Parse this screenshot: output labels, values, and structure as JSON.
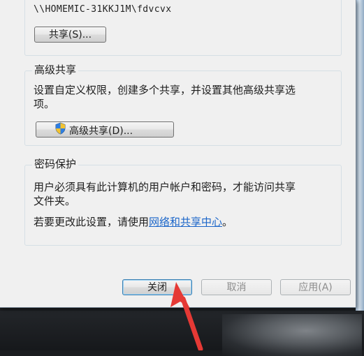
{
  "share": {
    "network_path": "\\\\HOMEMIC-31KKJ1M\\fdvcvx",
    "share_button": "共享(S)..."
  },
  "advanced": {
    "title": "高级共享",
    "description_line1": "设置自定义权限，创建多个共享，并设置其他高级共享选",
    "description_line2": "项。",
    "button": "高级共享(D)...",
    "icon": "uac-shield-icon"
  },
  "password": {
    "title": "密码保护",
    "description_line1": "用户必须具有此计算机的用户帐户和密码，才能访问共享",
    "description_line2": "文件夹。",
    "change_prefix": "若要更改此设置，请使用",
    "link": "网络和共享中心",
    "change_suffix": "。"
  },
  "footer": {
    "close": "关闭",
    "cancel": "取消",
    "apply": "应用(A)"
  },
  "colors": {
    "annotation_arrow": "#e53935",
    "link": "#1c66c9"
  }
}
